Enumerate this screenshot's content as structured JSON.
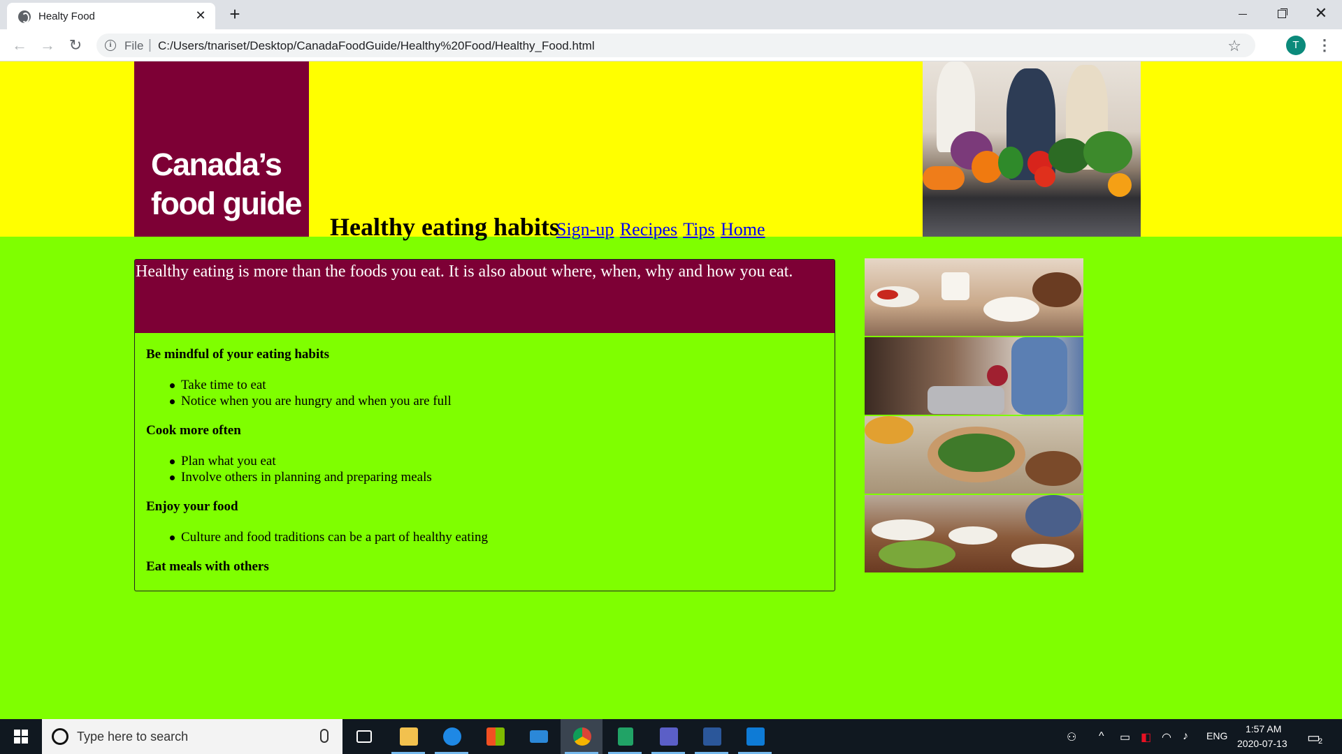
{
  "browser": {
    "tab_title": "Healty Food",
    "tab_close": "✕",
    "new_tab": "+",
    "file_label": "File",
    "url": "C:/Users/tnariset/Desktop/CanadaFoodGuide/Healthy%20Food/Healthy_Food.html",
    "profile_initial": "T",
    "back_icon": "back-arrow-icon",
    "forward_icon": "forward-arrow-icon",
    "reload_icon": "reload-icon",
    "bookmark_icon": "star-icon"
  },
  "header": {
    "logo_line1": "Canada’s",
    "logo_line2": "food guide",
    "title": "Healthy eating habits",
    "nav": [
      "Sign-up",
      "Recipes",
      "Tips",
      "Home"
    ],
    "colors": {
      "band": "#ffff00",
      "logo": "#7d0035",
      "link": "#0000ee"
    }
  },
  "main": {
    "intro": "Healthy eating is more than the foods you eat. It is also about where, when, why and how you eat.",
    "sections": [
      {
        "heading": "Be mindful of your eating habits",
        "items": [
          "Take time to eat",
          "Notice when you are hungry and when you are full"
        ]
      },
      {
        "heading": "Cook more often",
        "items": [
          "Plan what you eat",
          "Involve others in planning and preparing meals"
        ]
      },
      {
        "heading": "Enjoy your food",
        "items": [
          "Culture and food traditions can be a part of healthy eating"
        ]
      },
      {
        "heading": "Eat meals with others",
        "items": []
      }
    ],
    "colors": {
      "background": "#7fff00",
      "intro_bg": "#7d0035"
    }
  },
  "taskbar": {
    "search_placeholder": "Type here to search",
    "language": "ENG",
    "time": "1:57 AM",
    "date": "2020-07-13",
    "notification_count": "2"
  }
}
